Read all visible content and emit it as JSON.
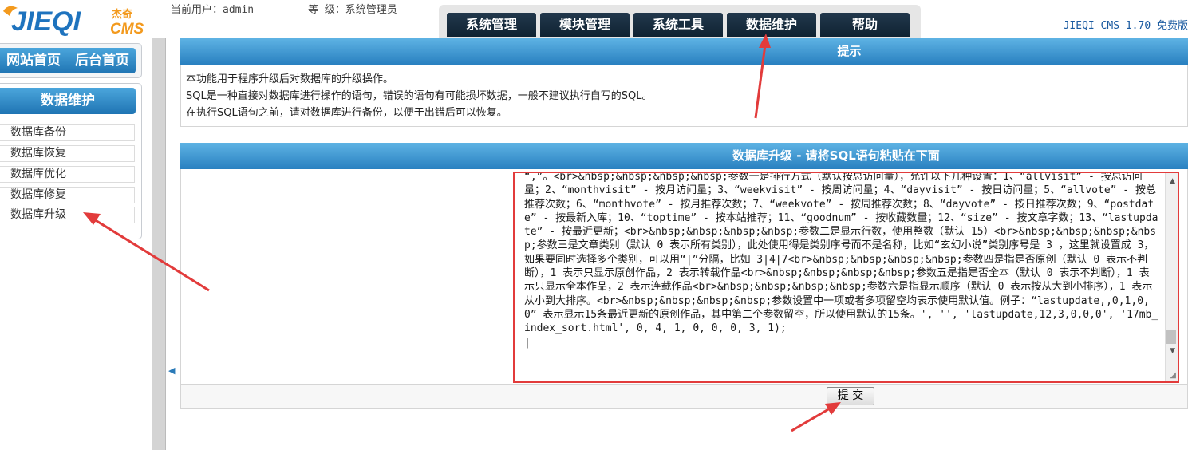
{
  "header": {
    "logo_text": "JIEQI",
    "logo_sub": "杰奇",
    "logo_cms": "CMS",
    "user_label": "当前用户：admin",
    "level_label": "等 级：系统管理员",
    "tabs": [
      {
        "label": "系统管理"
      },
      {
        "label": "模块管理"
      },
      {
        "label": "系统工具"
      },
      {
        "label": "数据维护"
      },
      {
        "label": "帮助"
      }
    ],
    "version": "JIEQI CMS 1.70 免费版"
  },
  "sidebar": {
    "home_link": "网站首页",
    "admin_link": "后台首页",
    "section_title": "数据维护",
    "items": [
      {
        "label": "数据库备份"
      },
      {
        "label": "数据库恢复"
      },
      {
        "label": "数据库优化"
      },
      {
        "label": "数据库修复"
      },
      {
        "label": "数据库升级"
      }
    ]
  },
  "main": {
    "hint_title": "提示",
    "hint_lines": [
      "本功能用于程序升级后对数据库的升级操作。",
      "SQL是一种直接对数据库进行操作的语句，错误的语句有可能损坏数据，一般不建议执行自写的SQL。",
      "在执行SQL语句之前，请对数据库进行备份，以便于出错后可以恢复。"
    ],
    "upgrade_title": "数据库升级 - 请将SQL语句粘贴在下面",
    "sql_value": "“,”。<br>&nbsp;&nbsp;&nbsp;&nbsp;参数一是排行方式（默认按总访问量），允许以下几种设置：1、“allvisit” - 按总访问量；2、“monthvisit” - 按月访问量；3、“weekvisit” - 按周访问量；4、“dayvisit” - 按日访问量；5、“allvote” - 按总推荐次数；6、“monthvote” - 按月推荐次数；7、“weekvote” - 按周推荐次数；8、“dayvote” - 按日推荐次数；9、“postdate” - 按最新入库；10、“toptime” - 按本站推荐；11、“goodnum” - 按收藏数量；12、“size” - 按文章字数；13、“lastupdate” - 按最近更新；<br>&nbsp;&nbsp;&nbsp;&nbsp;参数二是显示行数，使用整数（默认 15）<br>&nbsp;&nbsp;&nbsp;&nbsp;参数三是文章类别（默认 0 表示所有类别），此处使用得是类别序号而不是名称，比如“玄幻小说”类别序号是 3 ，这里就设置成 3，如果要同时选择多个类别，可以用“|”分隔，比如 3|4|7<br>&nbsp;&nbsp;&nbsp;&nbsp;参数四是指是否原创（默认 0 表示不判断），1 表示只显示原创作品，2 表示转载作品<br>&nbsp;&nbsp;&nbsp;&nbsp;参数五是指是否全本（默认 0 表示不判断），1 表示只显示全本作品，2 表示连载作品<br>&nbsp;&nbsp;&nbsp;&nbsp;参数六是指显示顺序（默认 0 表示按从大到小排序），1 表示从小到大排序。<br>&nbsp;&nbsp;&nbsp;&nbsp;参数设置中一项或者多项留空均表示使用默认值。例子：“lastupdate,,0,1,0,0” 表示显示15条最近更新的原创作品，其中第二个参数留空，所以使用默认的15条。', '', 'lastupdate,12,3,0,0,0', '17mb_index_sort.html', 0, 4, 1, 0, 0, 0, 3, 1);\n|",
    "submit_label": "提 交"
  },
  "colors": {
    "bar_blue": "#2980c0",
    "nav_dark": "#0f2232",
    "highlight_red": "#e23b3b"
  }
}
